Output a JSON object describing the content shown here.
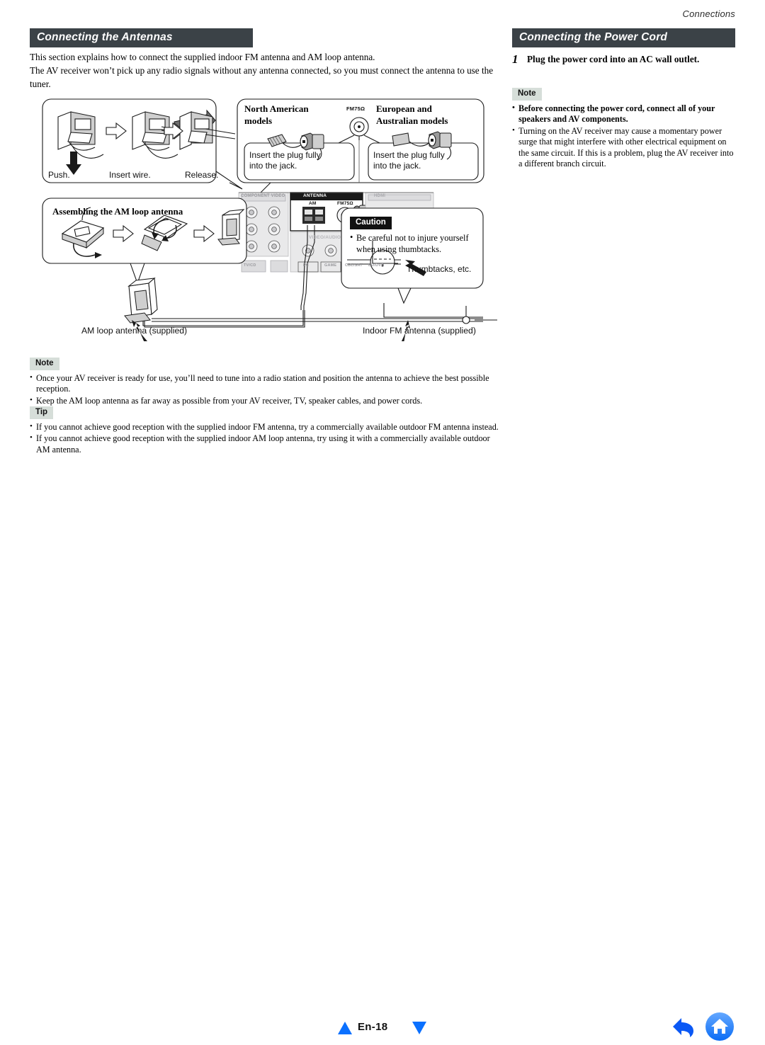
{
  "running_head": "Connections",
  "left_column": {
    "heading": "Connecting the Antennas",
    "intro_line_1": "This section explains how to connect the supplied indoor FM antenna and AM loop antenna.",
    "intro_line_2": "The AV receiver won’t pick up any radio signals without any antenna connected, so you must connect the antenna to use the tuner.",
    "note": {
      "badge": "Note",
      "items": [
        "Once your AV receiver is ready for use, you’ll need to tune into a radio station and position the antenna to achieve the best possible reception.",
        "Keep the AM loop antenna as far away as possible from your AV receiver, TV, speaker cables, and power cords."
      ]
    },
    "tip": {
      "badge": "Tip",
      "items": [
        "If you cannot achieve good reception with the supplied indoor FM antenna, try a commercially available outdoor FM antenna instead.",
        "If you cannot achieve good reception with the supplied indoor AM loop antenna, try using it with a commercially available outdoor AM antenna."
      ]
    }
  },
  "right_column": {
    "heading": "Connecting the Power Cord",
    "step": {
      "number": "1",
      "text": "Plug the power cord into an AC wall outlet."
    },
    "note": {
      "badge": "Note",
      "items": [
        "Before connecting the power cord, connect all of your speakers and AV components.",
        "Turning on the AV receiver may cause a momentary power surge that might interfere with other electrical equipment on the same circuit. If this is a problem, plug the AV receiver into a different branch circuit."
      ]
    }
  },
  "diagram": {
    "push_panel": {
      "step_1": "Push.",
      "step_2": "Insert wire.",
      "step_3": "Release."
    },
    "models_panel": {
      "north_american_title_line_1": "North American",
      "north_american_title_line_2": "models",
      "european_title_line_1": "European and",
      "european_title_line_2": "Australian models",
      "jack_label": "FM75Ω",
      "na_instruction_line_1": "Insert the plug fully",
      "na_instruction_line_2": "into the jack.",
      "eu_instruction_line_1": "Insert the plug fully",
      "eu_instruction_line_2": "into the jack."
    },
    "am_panel": {
      "title": "Assembling the AM loop antenna"
    },
    "caution_panel": {
      "badge": "Caution",
      "text_line_1": "Be careful not to injure yourself",
      "text_line_2": "when using thumbtacks.",
      "callout": "Thumbtacks, etc."
    },
    "rear_panel": {
      "antenna_block_label": "ANTENNA",
      "am_terminal_label": "AM",
      "fm_terminal_label": "FM75Ω",
      "component_video_label": "COMPONENT VIDEO",
      "video_label": "VIDEO/AUDIO",
      "hdmi_label": "HDMI",
      "jack_names": [
        "TV/CD",
        "PC",
        "GAME",
        "CBL/SAT",
        "BD/DVD"
      ]
    },
    "captions": {
      "am_antenna": "AM loop antenna (supplied)",
      "fm_antenna": "Indoor FM antenna (supplied)"
    }
  },
  "footer": {
    "page_label": "En-18",
    "prev_icon": "triangle-up-icon",
    "next_icon": "triangle-down-icon",
    "back_icon": "back-arrow-icon",
    "home_icon": "home-icon"
  },
  "colors": {
    "heading_bar": "#3b4247",
    "badge_bg": "#d6ded9",
    "caution_bg": "#111111",
    "nav_blue": "#0a70ff",
    "home_blue": "#2e8bff"
  }
}
